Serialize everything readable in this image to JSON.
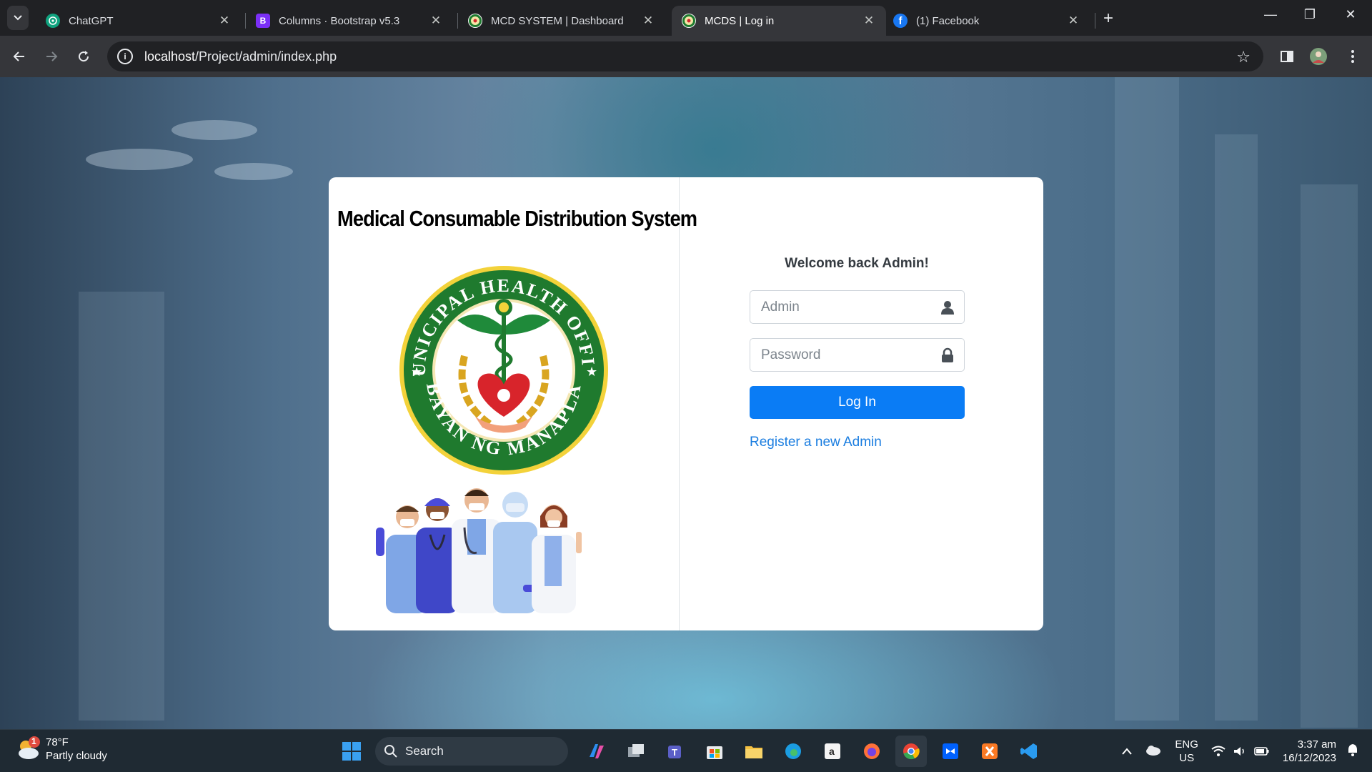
{
  "browser": {
    "tabs": [
      {
        "title": "ChatGPT",
        "icon": "chatgpt-icon",
        "active": false
      },
      {
        "title": "Columns · Bootstrap v5.3",
        "icon": "bootstrap-icon",
        "active": false
      },
      {
        "title": "MCD SYSTEM | Dashboard",
        "icon": "mho-seal-icon",
        "active": false
      },
      {
        "title": "MCDS | Log in",
        "icon": "mho-seal-icon",
        "active": true
      },
      {
        "title": "(1) Facebook",
        "icon": "facebook-icon",
        "active": false
      }
    ],
    "url_host": "localhost",
    "url_path": "/Project/admin/index.php"
  },
  "card": {
    "system_title": "Medical Consumable Distribution System",
    "seal_text_top": "MUNICIPAL HEALTH OFFICE",
    "seal_text_bottom": "BAYAN NG MANAPLA"
  },
  "login": {
    "welcome": "Welcome back Admin!",
    "username_placeholder": "Admin",
    "password_placeholder": "Password",
    "login_button": "Log In",
    "register_link": "Register a new Admin"
  },
  "taskbar": {
    "weather_temp": "78°F",
    "weather_desc": "Partly cloudy",
    "weather_badge": "1",
    "search_label": "Search",
    "lang_top": "ENG",
    "lang_bottom": "US",
    "time": "3:37 am",
    "date": "16/12/2023"
  },
  "colors": {
    "primary": "#0a7cf5",
    "link": "#1a7de0",
    "browser_bg": "#202124",
    "toolbar_bg": "#35363a"
  }
}
